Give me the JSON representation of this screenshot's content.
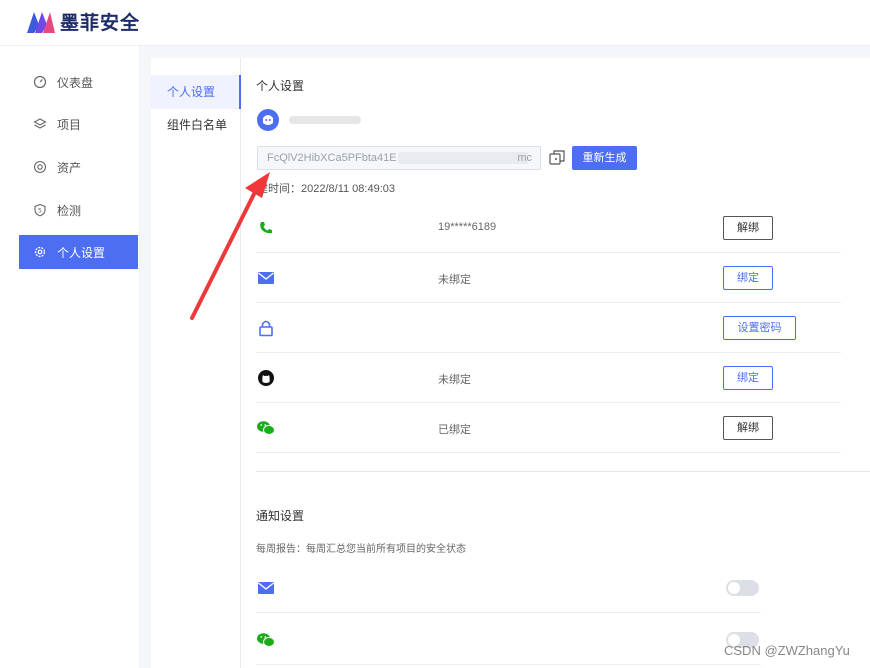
{
  "brand": {
    "name": "墨菲安全"
  },
  "sidebar": {
    "items": [
      {
        "label": "仪表盘",
        "icon": "gauge-icon"
      },
      {
        "label": "项目",
        "icon": "layers-icon"
      },
      {
        "label": "资产",
        "icon": "at-icon"
      },
      {
        "label": "检测",
        "icon": "shield-icon"
      },
      {
        "label": "个人设置",
        "icon": "gear-icon"
      }
    ],
    "active_index": 4
  },
  "subnav": {
    "items": [
      {
        "label": "个人设置"
      },
      {
        "label": "组件白名单"
      }
    ],
    "active_index": 0
  },
  "profile": {
    "section_title": "个人设置",
    "token_value": "FcQlV2HibXCa5PFbta41E",
    "token_tail": "mc",
    "regen_label": "重新生成",
    "created_time": "建时间：2022/8/11 08:49:03"
  },
  "bindings": [
    {
      "icon": "phone-icon",
      "value": "19*****6189",
      "button": "解绑",
      "style": "default"
    },
    {
      "icon": "mail-icon",
      "value": "未绑定",
      "button": "绑定",
      "style": "primary"
    },
    {
      "icon": "lock-icon",
      "value": "",
      "button": "设置密码",
      "style": "primary"
    },
    {
      "icon": "github-icon",
      "value": "未绑定",
      "button": "绑定",
      "style": "primary"
    },
    {
      "icon": "wechat-icon",
      "value": "已绑定",
      "button": "解绑",
      "style": "default"
    }
  ],
  "notify": {
    "section_title": "通知设置",
    "description": "每周报告：每周汇总您当前所有项目的安全状态",
    "channels": [
      {
        "icon": "mail-icon",
        "enabled": false
      },
      {
        "icon": "wechat-icon",
        "enabled": false
      }
    ]
  },
  "colors": {
    "accent": "#4e6ef2",
    "phone": "#1aad19",
    "annotation_arrow": "#f0373a"
  },
  "watermark": "CSDN @ZWZhangYu"
}
